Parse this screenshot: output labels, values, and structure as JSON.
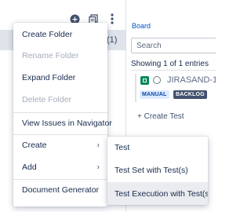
{
  "tree": {
    "selected_count": "(1)",
    "toolbar_icons": [
      "add-circle-icon",
      "copy-icon",
      "more-vertical-icon"
    ]
  },
  "board": {
    "title": "Board",
    "search_placeholder": "Search",
    "entries_text": "Showing 1 of 1 entries",
    "issue": {
      "key": "JIRASAND-18",
      "type_icon": "test-issue-type-icon",
      "labels": [
        "MANUAL",
        "BACKLOG"
      ]
    },
    "create_test_label": "+ Create Test"
  },
  "context_menu": {
    "items": [
      {
        "label": "Create Folder",
        "disabled": false
      },
      {
        "label": "Rename Folder",
        "disabled": true
      },
      {
        "label": "Expand Folder",
        "disabled": false
      },
      {
        "label": "Delete Folder",
        "disabled": true
      },
      {
        "label": "View Issues in Navigator",
        "disabled": false
      },
      {
        "label": "Create",
        "disabled": false,
        "submenu": true
      },
      {
        "label": "Add",
        "disabled": false,
        "submenu": true
      },
      {
        "label": "Document Generator",
        "disabled": false
      }
    ]
  },
  "submenu": {
    "items": [
      {
        "label": "Test"
      },
      {
        "label": "Test Set with Test(s)"
      },
      {
        "label": "Test Execution with Test(s)",
        "hovered": true
      }
    ]
  },
  "colors": {
    "selected_row": "#dfe3ea",
    "link": "#0052cc",
    "hover": "#ebecf0",
    "disabled_text": "#a5adba",
    "manual_lozenge": "#deebff",
    "backlog_lozenge": "#42526e",
    "test_icon": "#00875a"
  }
}
